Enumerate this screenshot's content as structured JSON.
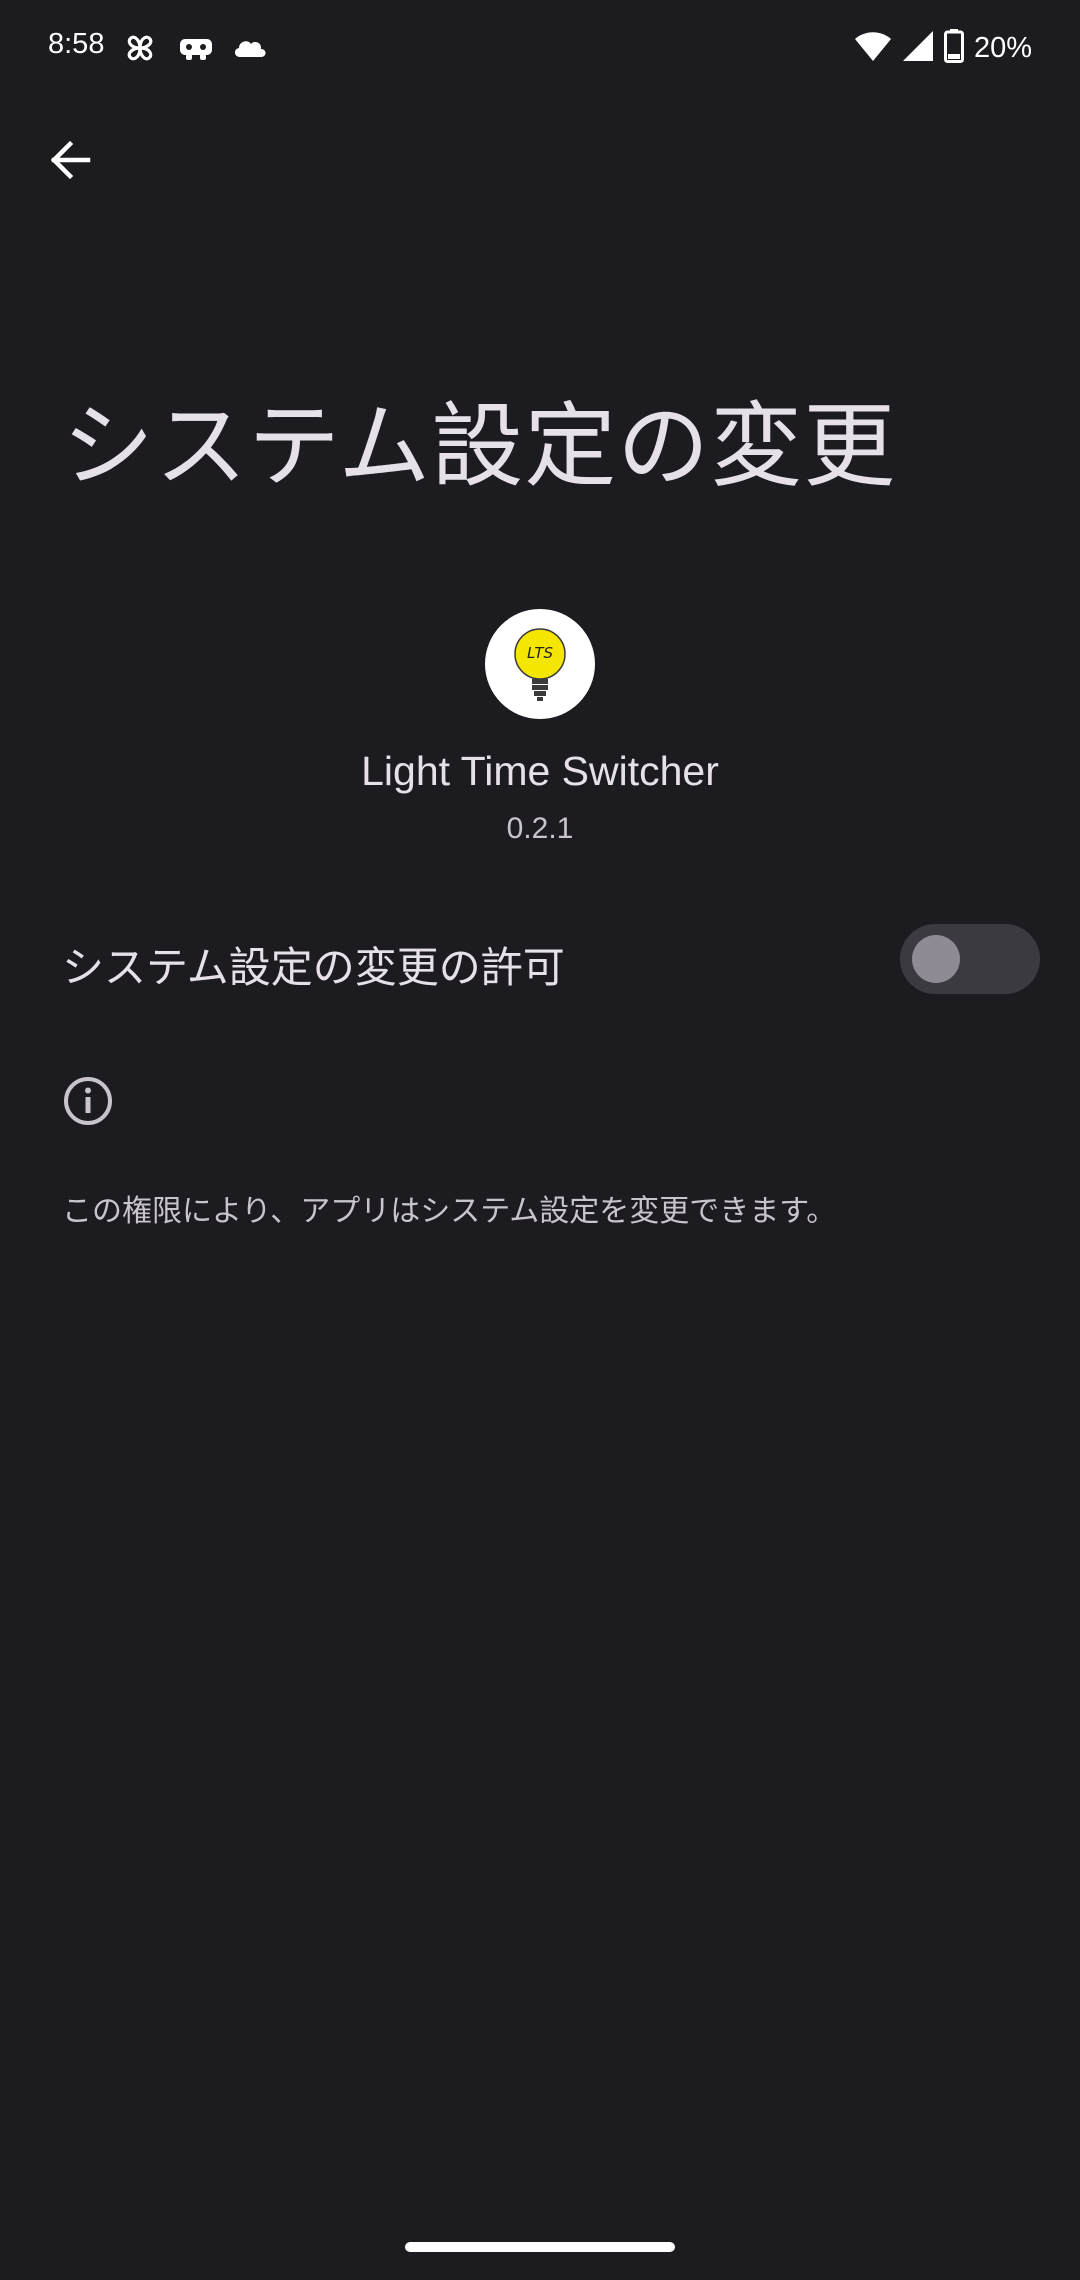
{
  "status_bar": {
    "time": "8:58",
    "battery_percent": "20%",
    "notification_icons": [
      "pinwheel-icon",
      "game-controller-icon",
      "cloud-icon"
    ],
    "system_icons": [
      "wifi-icon",
      "signal-icon",
      "battery-icon"
    ]
  },
  "navigation": {
    "back_icon": "arrow-left-icon"
  },
  "page": {
    "title": "システム設定の変更"
  },
  "app": {
    "icon_text": "LTS",
    "name": "Light Time Switcher",
    "version": "0.2.1"
  },
  "setting": {
    "label": "システム設定の変更の許可",
    "enabled": false
  },
  "info": {
    "icon": "info-icon",
    "text": "この権限により、アプリはシステム設定を変更できます。"
  },
  "colors": {
    "background": "#1c1b20",
    "text_primary": "#e6e1e8",
    "text_secondary": "#c9c4cc",
    "toggle_track_off": "#3b3a40",
    "toggle_thumb_off": "#8f8b94",
    "app_icon_bulb": "#f5e600"
  }
}
